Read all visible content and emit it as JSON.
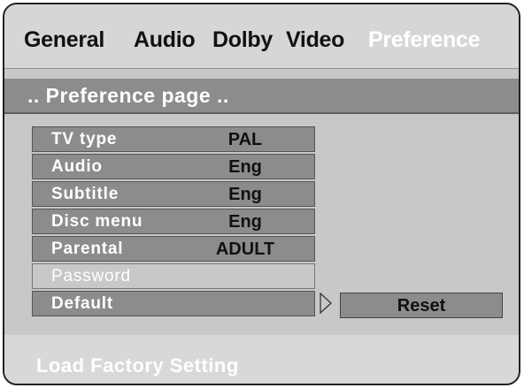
{
  "tabs": {
    "items": [
      {
        "label": "General"
      },
      {
        "label": "Audio"
      },
      {
        "label": "Dolby"
      },
      {
        "label": "Video"
      },
      {
        "label": "Preference"
      }
    ],
    "active": "Preference"
  },
  "page": {
    "title": ".. Preference  page .."
  },
  "menu": {
    "items": [
      {
        "label": "TV  type",
        "value": "PAL"
      },
      {
        "label": "Audio",
        "value": "Eng"
      },
      {
        "label": "Subtitle",
        "value": "Eng"
      },
      {
        "label": "Disc menu",
        "value": "Eng"
      },
      {
        "label": "Parental",
        "value": "ADULT"
      },
      {
        "label": "Password",
        "value": ""
      },
      {
        "label": "Default",
        "value": ""
      }
    ]
  },
  "submenu": {
    "option": "Reset"
  },
  "status": {
    "text": "Load Factory Setting"
  },
  "colors": {
    "row_bg": "#8c8c8c",
    "panel_bg": "#c8c8c8",
    "active_tab": "#ffffff",
    "arrow_icon": "triangle-right-outline"
  }
}
